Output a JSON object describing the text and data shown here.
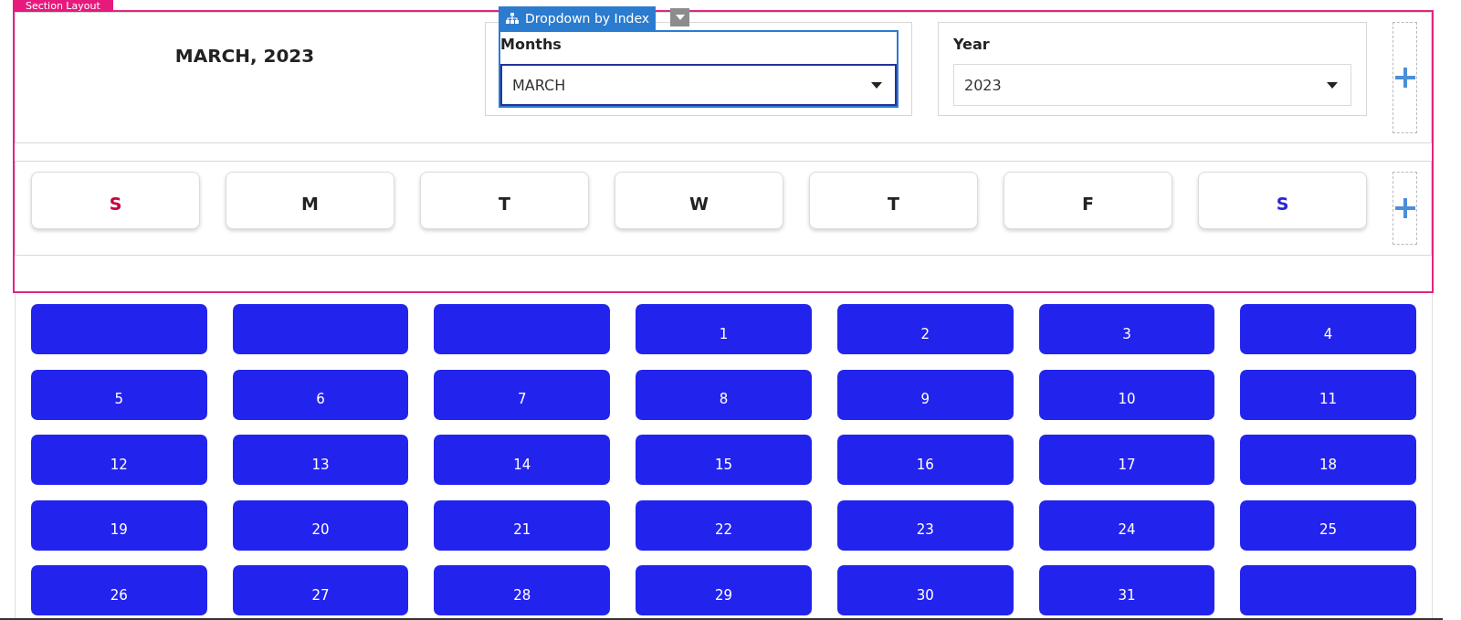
{
  "section": {
    "tag": "Section Layout"
  },
  "header": {
    "title": "MARCH, 2023",
    "fields": [
      {
        "label": "Months",
        "value": "MARCH",
        "selected": true,
        "tag": "Dropdown by Index"
      },
      {
        "label": "Year",
        "value": "2023",
        "selected": false
      }
    ]
  },
  "weekdays": [
    {
      "label": "S",
      "color": "#c8003c"
    },
    {
      "label": "M",
      "color": "#222222"
    },
    {
      "label": "T",
      "color": "#222222"
    },
    {
      "label": "W",
      "color": "#222222"
    },
    {
      "label": "T",
      "color": "#222222"
    },
    {
      "label": "F",
      "color": "#222222"
    },
    {
      "label": "S",
      "color": "#2b24d6"
    }
  ],
  "days": [
    {
      "kind": "blank"
    },
    {
      "kind": "blank"
    },
    {
      "kind": "blank"
    },
    {
      "kind": "day",
      "label": "1"
    },
    {
      "kind": "day",
      "label": "2"
    },
    {
      "kind": "day",
      "label": "3"
    },
    {
      "kind": "day",
      "label": "4"
    },
    {
      "kind": "day",
      "label": "5"
    },
    {
      "kind": "day",
      "label": "6"
    },
    {
      "kind": "day",
      "label": "7"
    },
    {
      "kind": "day",
      "label": "8"
    },
    {
      "kind": "day",
      "label": "9"
    },
    {
      "kind": "day",
      "label": "10"
    },
    {
      "kind": "day",
      "label": "11"
    },
    {
      "kind": "day",
      "label": "12"
    },
    {
      "kind": "day",
      "label": "13"
    },
    {
      "kind": "day",
      "label": "14"
    },
    {
      "kind": "day",
      "label": "15"
    },
    {
      "kind": "day",
      "label": "16"
    },
    {
      "kind": "day",
      "label": "17"
    },
    {
      "kind": "day",
      "label": "18"
    },
    {
      "kind": "day",
      "label": "19"
    },
    {
      "kind": "day",
      "label": "20"
    },
    {
      "kind": "day",
      "label": "21"
    },
    {
      "kind": "day",
      "label": "22"
    },
    {
      "kind": "day",
      "label": "23"
    },
    {
      "kind": "day",
      "label": "24"
    },
    {
      "kind": "day",
      "label": "25"
    },
    {
      "kind": "day",
      "label": "26"
    },
    {
      "kind": "day",
      "label": "27"
    },
    {
      "kind": "day",
      "label": "28"
    },
    {
      "kind": "day",
      "label": "29"
    },
    {
      "kind": "day",
      "label": "30"
    },
    {
      "kind": "day",
      "label": "31"
    },
    {
      "kind": "blank"
    }
  ]
}
